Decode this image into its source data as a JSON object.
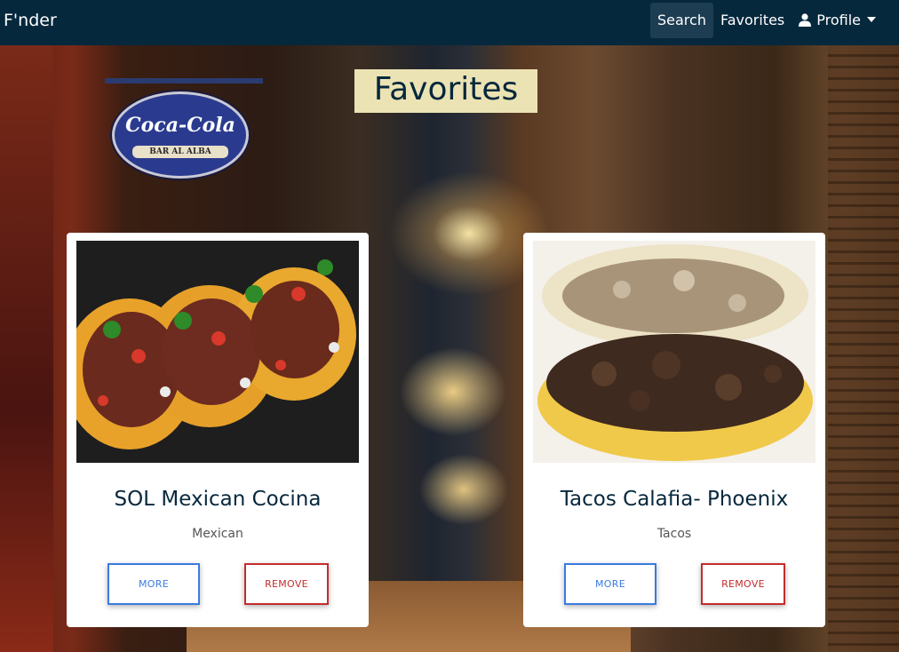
{
  "navbar": {
    "brand": "F'nder",
    "links": [
      {
        "label": "Search"
      },
      {
        "label": "Favorites"
      },
      {
        "label": "Profile"
      }
    ]
  },
  "page": {
    "title": "Favorites"
  },
  "background_sign": {
    "brand": "Coca-Cola",
    "subtitle": "BAR AL ALBA"
  },
  "favorites": [
    {
      "name": "SOL Mexican Cocina",
      "cuisine": "Mexican",
      "more_label": "MORE",
      "remove_label": "REMOVE",
      "image_icon": "tacos-photo"
    },
    {
      "name": "Tacos Calafia- Phoenix",
      "cuisine": "Tacos",
      "more_label": "MORE",
      "remove_label": "REMOVE",
      "image_icon": "tacos-photo"
    }
  ],
  "colors": {
    "navbar_bg": "#06283d",
    "title_bg": "#ebe3b3",
    "more_accent": "#3a7be0",
    "remove_accent": "#c32c2c"
  }
}
